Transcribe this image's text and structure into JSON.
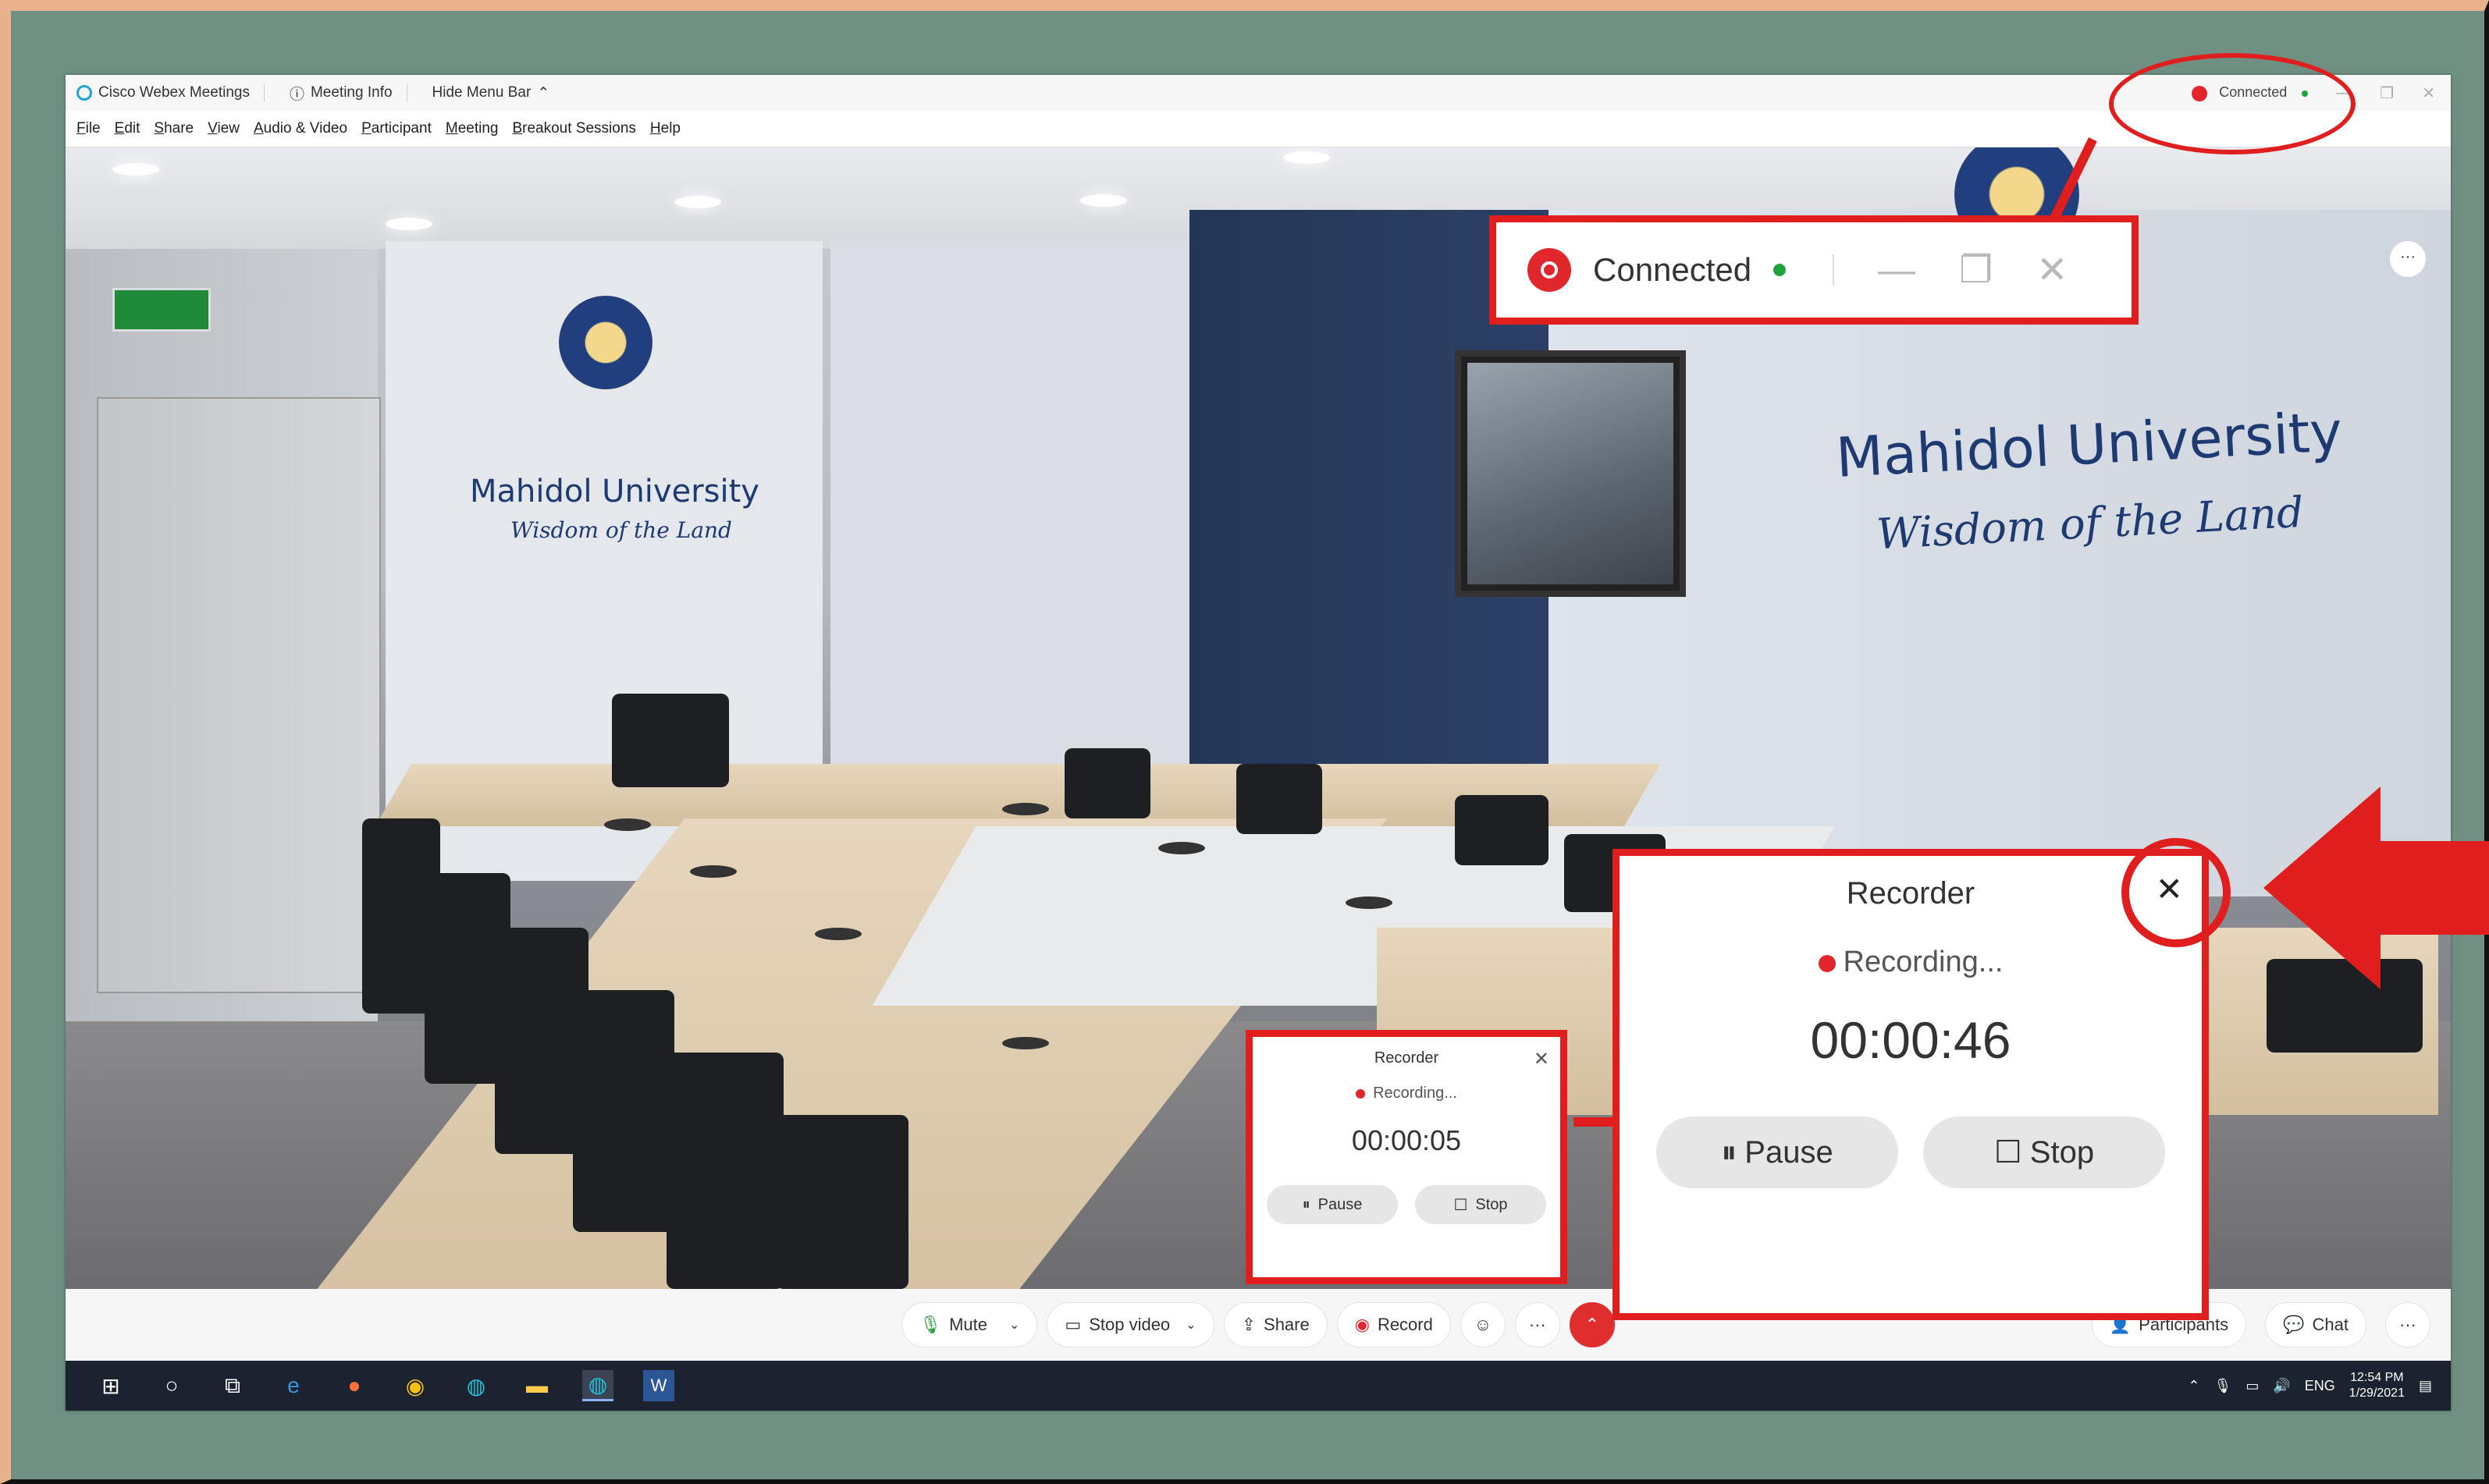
{
  "window": {
    "app_title": "Cisco Webex Meetings",
    "meeting_info": "Meeting Info",
    "hide_menu_bar": "Hide Menu Bar",
    "status": "Connected"
  },
  "menu": [
    "File",
    "Edit",
    "Share",
    "View",
    "Audio & Video",
    "Participant",
    "Meeting",
    "Breakout Sessions",
    "Help"
  ],
  "video_scene": {
    "wall_left_title": "Mahidol University",
    "wall_left_subtitle": "Wisdom of the Land",
    "wall_right_title": "Mahidol University",
    "wall_right_subtitle": "Wisdom of the Land"
  },
  "callout_connected": {
    "label": "Connected"
  },
  "recorder_small": {
    "title": "Recorder",
    "status": "Recording...",
    "time": "00:00:05",
    "pause_label": "Pause",
    "stop_label": "Stop"
  },
  "recorder_large": {
    "title": "Recorder",
    "status": "Recording...",
    "time": "00:00:46",
    "pause_label": "Pause",
    "stop_label": "Stop"
  },
  "toolbar": {
    "mute": "Mute",
    "stop_video": "Stop video",
    "share": "Share",
    "record": "Record",
    "participants": "Participants",
    "chat": "Chat"
  },
  "taskbar": {
    "lang": "ENG",
    "time": "12:54 PM",
    "date": "1/29/2021"
  },
  "colors": {
    "annotation_red": "#e01e1e",
    "connected_green": "#21a33b",
    "record_red": "#e1262c",
    "background": "#6f8f83"
  }
}
